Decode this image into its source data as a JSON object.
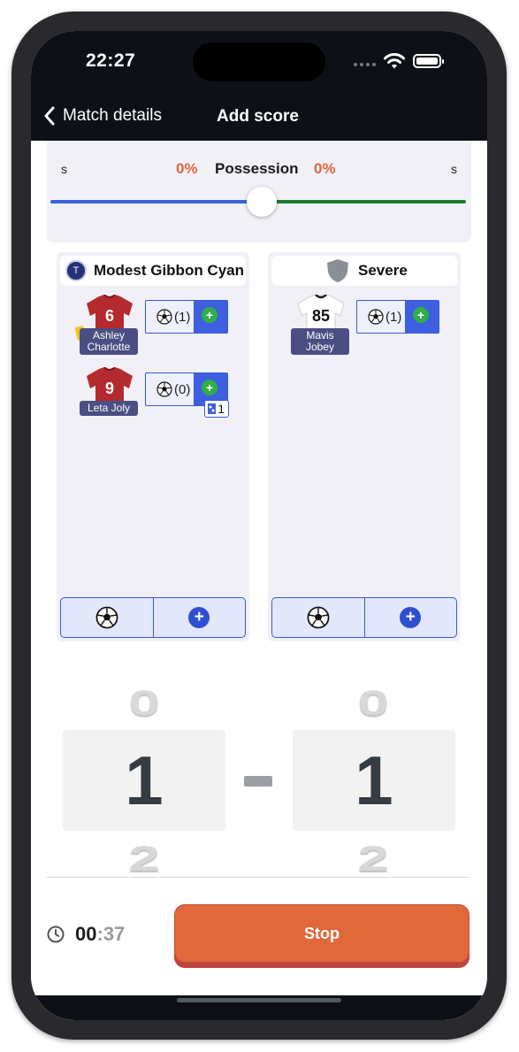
{
  "status_bar": {
    "time": "22:27"
  },
  "nav": {
    "back_label": "Match details",
    "title": "Add score"
  },
  "possession": {
    "label": "Possession",
    "left_percent": "0%",
    "right_percent": "0%",
    "left_side": "s",
    "right_side": "s",
    "slider_value": 0.5,
    "left_color": "#3864d8",
    "right_color": "#1f7a32"
  },
  "home_team": {
    "name": "Modest Gibbon Cyan",
    "avatar_letter": "T",
    "players": [
      {
        "number": "6",
        "name": "Ashley Charlotte",
        "goals": "(1)",
        "yellow_card": true
      },
      {
        "number": "9",
        "name": "Leta Joly",
        "goals": "(0)",
        "sub_count": "1"
      }
    ]
  },
  "away_team": {
    "name": "Severe",
    "players": [
      {
        "number": "85",
        "name": "Mavis Jobey",
        "goals": "(1)"
      }
    ]
  },
  "score": {
    "home": "1",
    "away": "1",
    "home_above": "0",
    "home_below": "2",
    "away_above": "0",
    "away_below": "2"
  },
  "timer": {
    "minutes": "00",
    "separator": ":",
    "seconds": "37"
  },
  "stop_label": "Stop",
  "colors": {
    "accent": "#e0683b",
    "primary_blue": "#3d5fe0",
    "home_jersey": "#b52a2e",
    "away_jersey": "#ffffff"
  }
}
